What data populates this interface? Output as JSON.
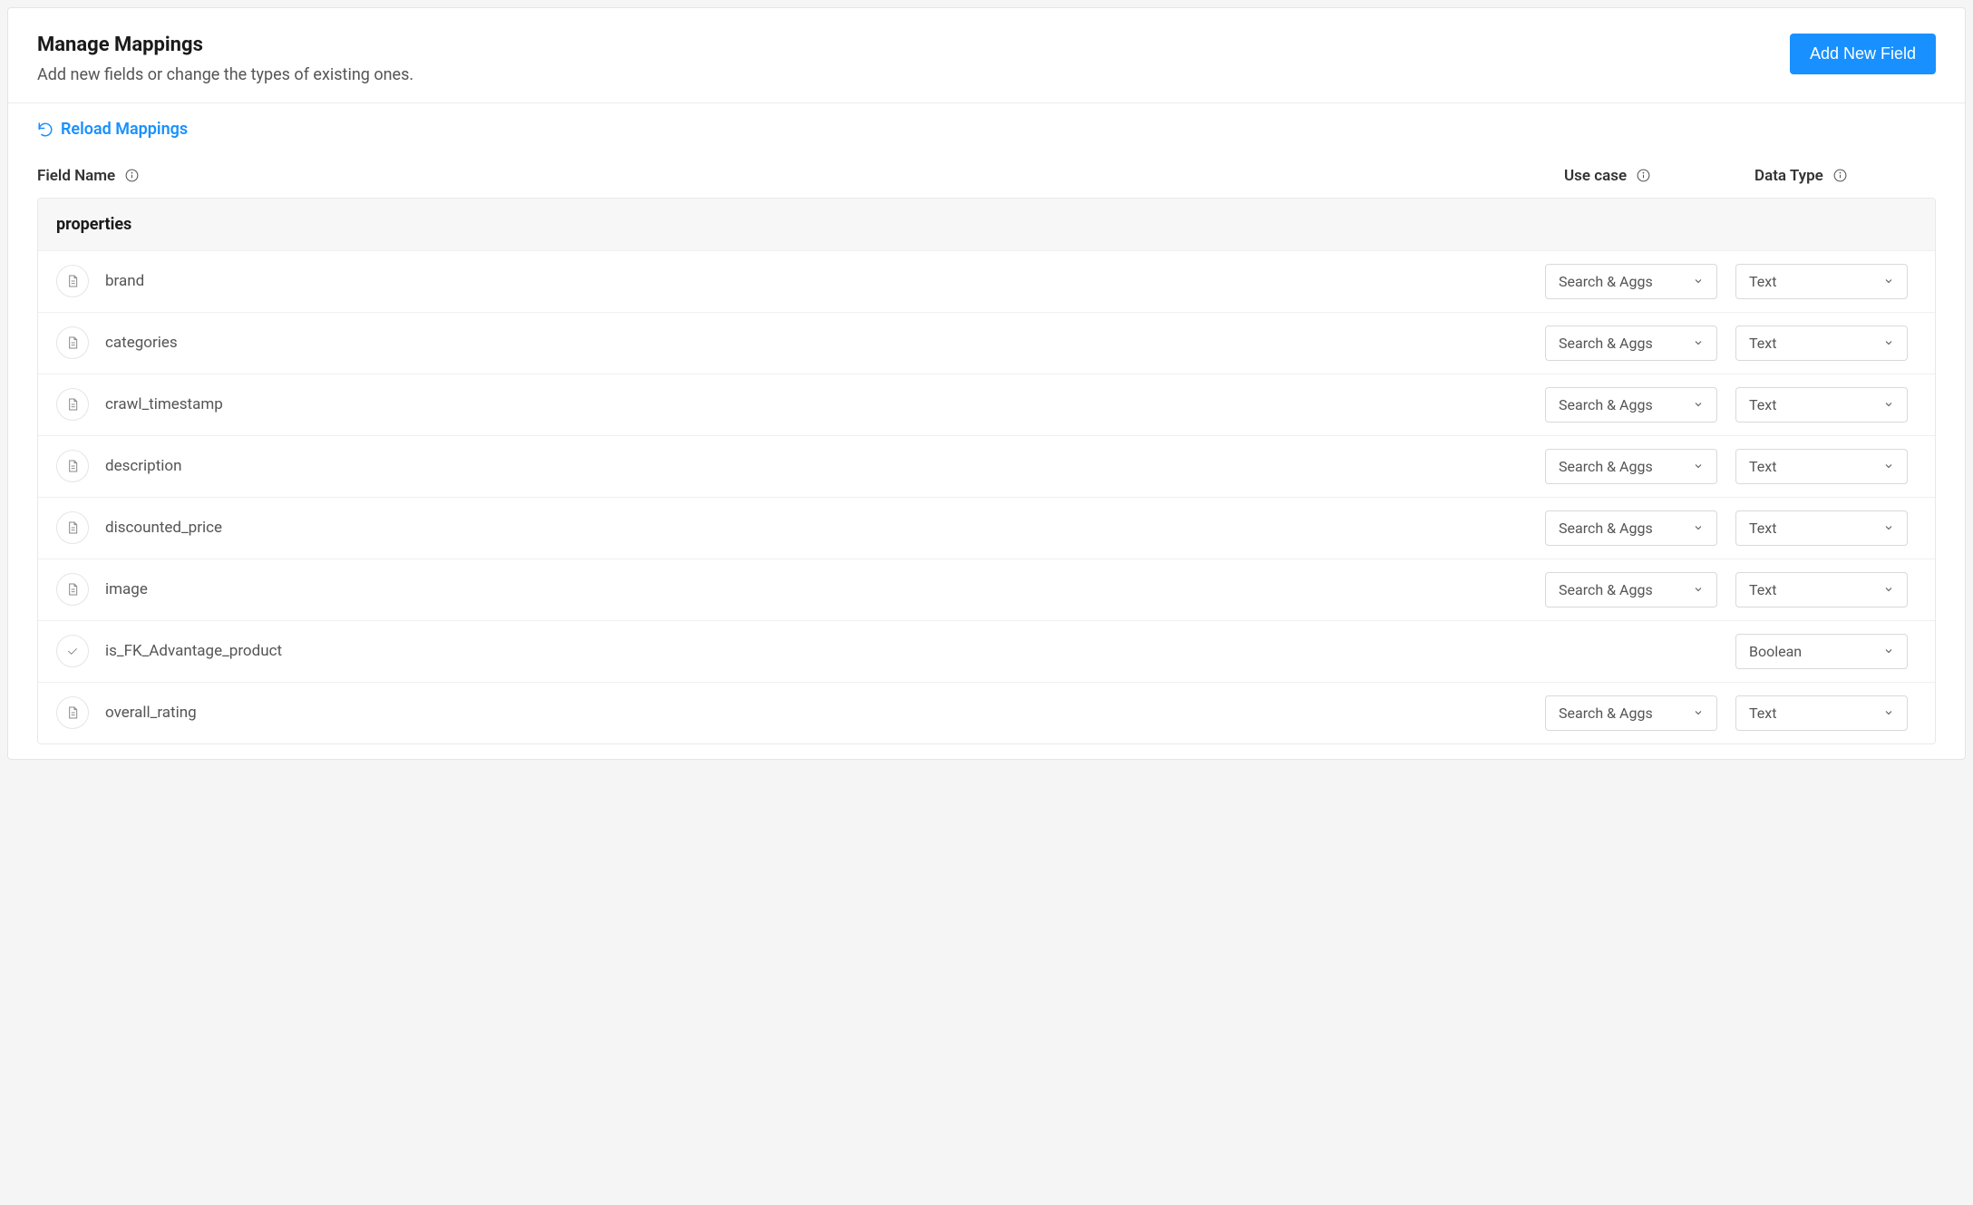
{
  "header": {
    "title": "Manage Mappings",
    "subtitle": "Add new fields or change the types of existing ones.",
    "add_button": "Add New Field"
  },
  "toolbar": {
    "reload_label": "Reload Mappings"
  },
  "columns": {
    "field_name": "Field Name",
    "use_case": "Use case",
    "data_type": "Data Type"
  },
  "table": {
    "group_label": "properties",
    "rows": [
      {
        "name": "brand",
        "icon": "document",
        "use_case": "Search & Aggs",
        "data_type": "Text"
      },
      {
        "name": "categories",
        "icon": "document",
        "use_case": "Search & Aggs",
        "data_type": "Text"
      },
      {
        "name": "crawl_timestamp",
        "icon": "document",
        "use_case": "Search & Aggs",
        "data_type": "Text"
      },
      {
        "name": "description",
        "icon": "document",
        "use_case": "Search & Aggs",
        "data_type": "Text"
      },
      {
        "name": "discounted_price",
        "icon": "document",
        "use_case": "Search & Aggs",
        "data_type": "Text"
      },
      {
        "name": "image",
        "icon": "document",
        "use_case": "Search & Aggs",
        "data_type": "Text"
      },
      {
        "name": "is_FK_Advantage_product",
        "icon": "check",
        "use_case": "",
        "data_type": "Boolean"
      },
      {
        "name": "overall_rating",
        "icon": "document",
        "use_case": "Search & Aggs",
        "data_type": "Text"
      }
    ]
  }
}
